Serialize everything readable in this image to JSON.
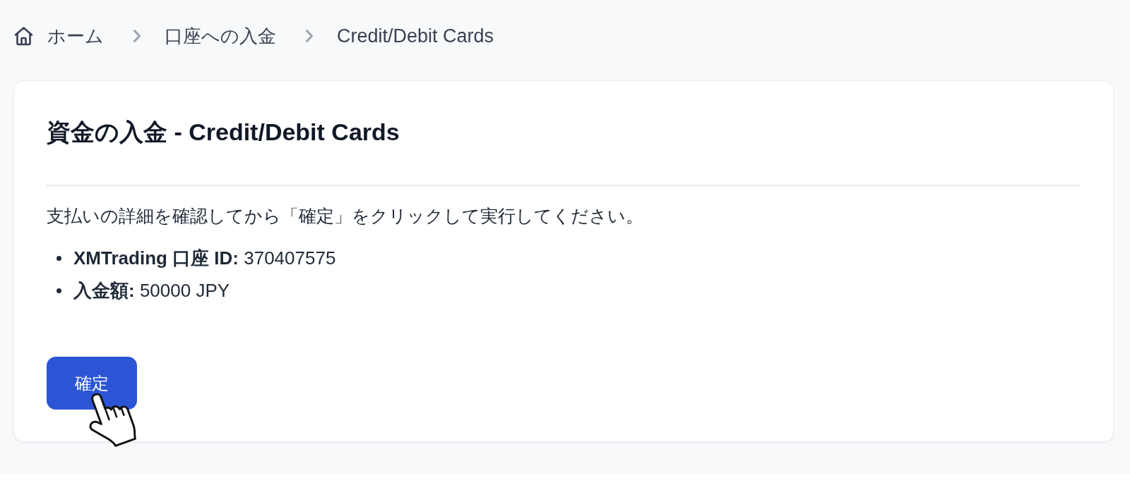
{
  "breadcrumb": [
    {
      "kind": "home",
      "label": "ホーム"
    },
    {
      "kind": "link",
      "label": "口座への入金"
    },
    {
      "kind": "current",
      "label": "Credit/Debit Cards"
    }
  ],
  "card": {
    "title": "資金の入金 - Credit/Debit Cards",
    "instruction": "支払いの詳細を確認してから「確定」をクリックして実行してください。",
    "details": [
      "**XMTrading 口座 ID:** 370407575",
      "**入金額:** 50000 JPY"
    ],
    "confirm_button": "確定"
  }
}
